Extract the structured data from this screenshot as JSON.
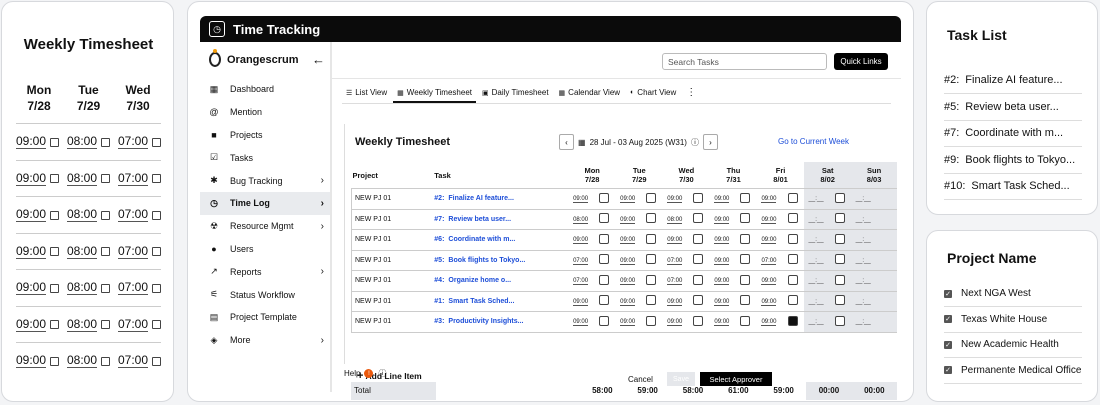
{
  "left_card": {
    "title": "Weekly Timesheet",
    "days": [
      {
        "day": "Mon",
        "date": "7/28"
      },
      {
        "day": "Tue",
        "date": "7/29"
      },
      {
        "day": "Wed",
        "date": "7/30"
      }
    ],
    "rows": [
      [
        "09:00",
        "08:00",
        "07:00"
      ],
      [
        "09:00",
        "08:00",
        "07:00"
      ],
      [
        "09:00",
        "08:00",
        "07:00"
      ],
      [
        "09:00",
        "08:00",
        "07:00"
      ],
      [
        "09:00",
        "08:00",
        "07:00"
      ],
      [
        "09:00",
        "08:00",
        "07:00"
      ],
      [
        "09:00",
        "08:00",
        "07:00"
      ]
    ]
  },
  "window": {
    "title": "Time Tracking"
  },
  "sidebar": {
    "brand": "Orangescrum",
    "back_icon": "arrow-left-icon",
    "items": [
      {
        "label": "Dashboard",
        "icon": "dashboard-icon",
        "glyph": "▦",
        "chevron": false,
        "active": false
      },
      {
        "label": "Mention",
        "icon": "at-icon",
        "glyph": "@",
        "chevron": false,
        "active": false
      },
      {
        "label": "Projects",
        "icon": "briefcase-icon",
        "glyph": "■",
        "chevron": false,
        "active": false
      },
      {
        "label": "Tasks",
        "icon": "check-square-icon",
        "glyph": "☑",
        "chevron": false,
        "active": false
      },
      {
        "label": "Bug Tracking",
        "icon": "bug-icon",
        "glyph": "✱",
        "chevron": true,
        "active": false
      },
      {
        "label": "Time Log",
        "icon": "clock-icon",
        "glyph": "◷",
        "chevron": true,
        "active": true
      },
      {
        "label": "Resource Mgmt",
        "icon": "resource-icon",
        "glyph": "☢",
        "chevron": true,
        "active": false
      },
      {
        "label": "Users",
        "icon": "user-icon",
        "glyph": "●",
        "chevron": false,
        "active": false
      },
      {
        "label": "Reports",
        "icon": "trend-icon",
        "glyph": "↗",
        "chevron": true,
        "active": false
      },
      {
        "label": "Status Workflow",
        "icon": "workflow-icon",
        "glyph": "⚟",
        "chevron": false,
        "active": false
      },
      {
        "label": "Project Template",
        "icon": "template-icon",
        "glyph": "▤",
        "chevron": false,
        "active": false
      },
      {
        "label": "More",
        "icon": "layers-icon",
        "glyph": "◈",
        "chevron": true,
        "active": false
      }
    ]
  },
  "header": {
    "search_placeholder": "Search Tasks",
    "quick_links": "Quick Links"
  },
  "tabs": [
    {
      "label": "List View",
      "glyph": "☰",
      "active": false
    },
    {
      "label": "Weekly Timesheet",
      "glyph": "▦",
      "active": true
    },
    {
      "label": "Daily Timesheet",
      "glyph": "▣",
      "active": false
    },
    {
      "label": "Calendar View",
      "glyph": "▦",
      "active": false
    },
    {
      "label": "Chart View",
      "glyph": "◐",
      "active": false
    }
  ],
  "sheet": {
    "title": "Weekly Timesheet",
    "date_range": "28 Jul - 03 Aug 2025 (W31)",
    "goto": "Go to Current Week",
    "columns": {
      "project": "Project",
      "task": "Task"
    },
    "days": [
      {
        "day": "Mon",
        "date": "7/28",
        "weekend": false
      },
      {
        "day": "Tue",
        "date": "7/29",
        "weekend": false
      },
      {
        "day": "Wed",
        "date": "7/30",
        "weekend": false
      },
      {
        "day": "Thu",
        "date": "7/31",
        "weekend": false
      },
      {
        "day": "Fri",
        "date": "8/01",
        "weekend": false
      },
      {
        "day": "Sat",
        "date": "8/02",
        "weekend": true
      },
      {
        "day": "Sun",
        "date": "8/03",
        "weekend": true
      }
    ],
    "rows": [
      {
        "project": "NEW PJ 01",
        "num": "#2:",
        "task": "Finalize AI feature...",
        "values": [
          "09:00",
          "09:00",
          "09:00",
          "09:00",
          "09:00",
          "__:__",
          "__:__"
        ],
        "checked": [
          false,
          false,
          false,
          false,
          false,
          false
        ]
      },
      {
        "project": "NEW PJ 01",
        "num": "#7:",
        "task": "Review beta user...",
        "values": [
          "08:00",
          "09:00",
          "08:00",
          "09:00",
          "09:00",
          "__:__",
          "__:__"
        ],
        "checked": [
          false,
          false,
          false,
          false,
          false,
          false
        ]
      },
      {
        "project": "NEW PJ 01",
        "num": "#6:",
        "task": "Coordinate with m...",
        "values": [
          "09:00",
          "09:00",
          "09:00",
          "09:00",
          "09:00",
          "__:__",
          "__:__"
        ],
        "checked": [
          false,
          false,
          false,
          false,
          false,
          false
        ]
      },
      {
        "project": "NEW PJ 01",
        "num": "#5:",
        "task": "Book flights to Tokyo...",
        "values": [
          "07:00",
          "09:00",
          "07:00",
          "09:00",
          "07:00",
          "__:__",
          "__:__"
        ],
        "checked": [
          false,
          false,
          false,
          false,
          false,
          false
        ]
      },
      {
        "project": "NEW PJ 01",
        "num": "#4:",
        "task": "Organize home o...",
        "values": [
          "07:00",
          "09:00",
          "07:00",
          "09:00",
          "09:00",
          "__:__",
          "__:__"
        ],
        "checked": [
          false,
          false,
          false,
          false,
          false,
          false
        ]
      },
      {
        "project": "NEW PJ 01",
        "num": "#1:",
        "task": "Smart Task Sched...",
        "values": [
          "09:00",
          "09:00",
          "09:00",
          "09:00",
          "09:00",
          "__:__",
          "__:__"
        ],
        "checked": [
          false,
          false,
          false,
          false,
          false,
          false
        ]
      },
      {
        "project": "NEW PJ 01",
        "num": "#3:",
        "task": "Productivity Insights...",
        "values": [
          "09:00",
          "09:00",
          "09:00",
          "09:00",
          "09:00",
          "__:__",
          "__:__"
        ],
        "checked": [
          false,
          false,
          false,
          false,
          true,
          false
        ]
      }
    ],
    "add_line": "Add Line Item",
    "total_label": "Total",
    "totals": [
      "58:00",
      "59:00",
      "58:00",
      "61:00",
      "59:00",
      "00:00",
      "00:00"
    ]
  },
  "footer": {
    "help": "Help",
    "help_badge": "!",
    "cancel": "Cancel",
    "disabled_btn": "Save",
    "select_approver": "Select Approver"
  },
  "task_list": {
    "title": "Task List",
    "items": [
      {
        "num": "#2:",
        "name": "Finalize AI feature..."
      },
      {
        "num": "#5:",
        "name": "Review beta user..."
      },
      {
        "num": "#7:",
        "name": "Coordinate with m..."
      },
      {
        "num": "#9:",
        "name": "Book flights to Tokyo..."
      },
      {
        "num": "#10:",
        "name": "Smart Task Sched..."
      }
    ]
  },
  "project_list": {
    "title": "Project Name",
    "items": [
      "Next NGA West",
      "Texas White House",
      "New Academic Health",
      "Permanente Medical Office"
    ]
  }
}
